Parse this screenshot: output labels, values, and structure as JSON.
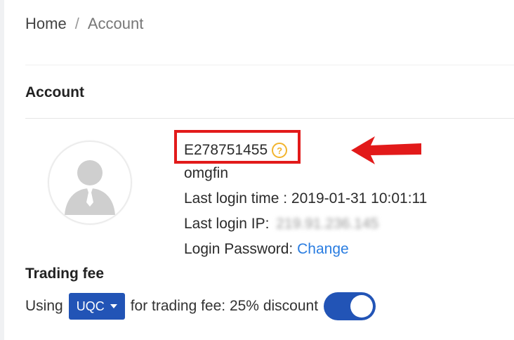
{
  "breadcrumb": {
    "home": "Home",
    "separator": "/",
    "current": "Account"
  },
  "account": {
    "section_title": "Account",
    "user_id": "E278751455",
    "help_icon": "question-circle-icon",
    "username": "omgfin",
    "last_login_time_label": "Last login time :",
    "last_login_time_value": "2019-01-31 10:01:11",
    "last_login_ip_label": "Last login IP:",
    "last_login_ip_value": "219.91.236.145",
    "login_password_label": "Login Password:",
    "change_link": "Change",
    "avatar_icon": "default-user-icon"
  },
  "trading_fee": {
    "title": "Trading fee",
    "using_label": "Using",
    "coin_selected": "UQC",
    "suffix_text": "for trading fee: 25% discount",
    "toggle_on": true
  },
  "annotation": {
    "arrow_icon": "red-arrow-left-icon",
    "highlight_color": "#e21a1a"
  },
  "colors": {
    "accent": "#2254b6",
    "link": "#2a7de1",
    "help_icon": "#f2b42d"
  }
}
